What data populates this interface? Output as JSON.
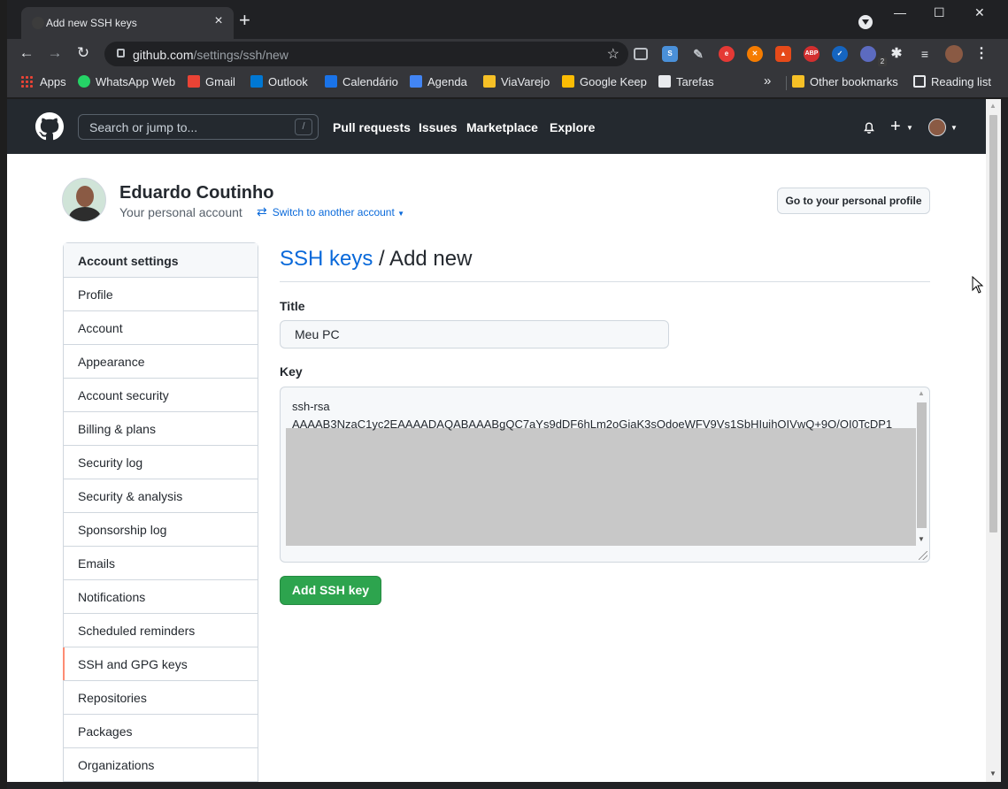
{
  "browser": {
    "tab_title": "Add new SSH keys",
    "tab_close": "×",
    "new_tab": "+",
    "window_controls": {
      "minimize": "—",
      "maximize": "☐",
      "close": "✕"
    },
    "url_host": "github.com",
    "url_path": "/settings/ssh/new",
    "extension_badge": "2",
    "ext_labels": {
      "ext_e": "e",
      "abp": "ABP"
    }
  },
  "bookmarks": {
    "apps": "Apps",
    "items": [
      "WhatsApp Web",
      "Gmail",
      "Outlook",
      "Calendário",
      "Agenda",
      "ViaVarejo",
      "Google Keep",
      "Tarefas"
    ],
    "overflow": "»",
    "other": "Other bookmarks",
    "reading": "Reading list"
  },
  "github": {
    "search_placeholder": "Search or jump to...",
    "search_shortcut": "/",
    "nav": [
      "Pull requests",
      "Issues",
      "Marketplace",
      "Explore"
    ],
    "plus": "+"
  },
  "profile": {
    "name": "Eduardo Coutinho",
    "subtitle": "Your personal account",
    "switch": "Switch to another account",
    "profile_button": "Go to your personal profile"
  },
  "sidebar": {
    "heading": "Account settings",
    "items": [
      "Profile",
      "Account",
      "Appearance",
      "Account security",
      "Billing & plans",
      "Security log",
      "Security & analysis",
      "Sponsorship log",
      "Emails",
      "Notifications",
      "Scheduled reminders",
      "SSH and GPG keys",
      "Repositories",
      "Packages",
      "Organizations"
    ],
    "selected": "SSH and GPG keys"
  },
  "form": {
    "breadcrumb_link": "SSH keys",
    "breadcrumb_rest": " / Add new",
    "title_label": "Title",
    "title_value": "Meu PC",
    "key_label": "Key",
    "key_line1": "ssh-rsa",
    "key_line2": "AAAAB3NzaC1yc2EAAAADAQABAAABgQC7aYs9dDF6hLm2oGiaK3sOdoeWFV9Vs1SbHIuihOIVwQ+9O/OI0TcDP1",
    "submit": "Add SSH key"
  },
  "colors": {
    "header_bg": "#24292f",
    "link": "#0969da",
    "primary_button": "#2da44e",
    "selected_marker": "#fd8c73"
  }
}
